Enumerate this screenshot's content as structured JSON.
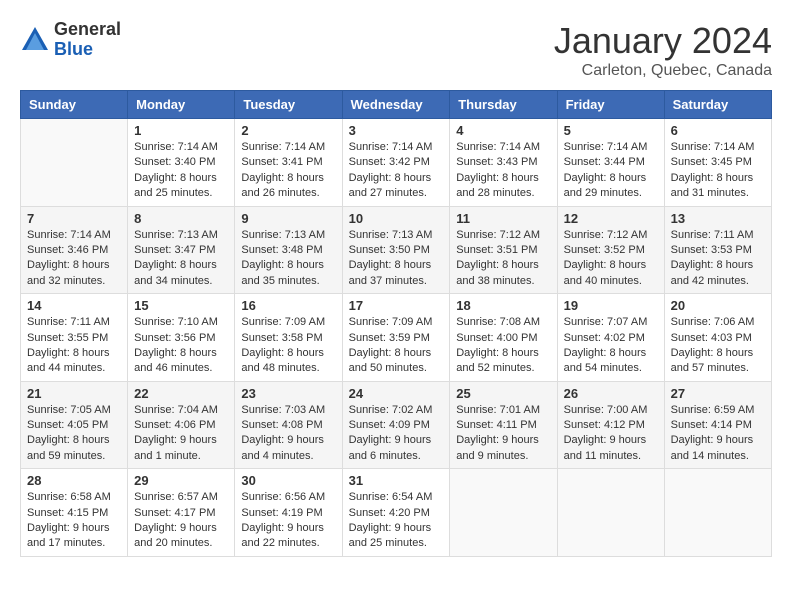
{
  "logo": {
    "general": "General",
    "blue": "Blue"
  },
  "header": {
    "title": "January 2024",
    "subtitle": "Carleton, Quebec, Canada"
  },
  "days_of_week": [
    "Sunday",
    "Monday",
    "Tuesday",
    "Wednesday",
    "Thursday",
    "Friday",
    "Saturday"
  ],
  "weeks": [
    [
      {
        "day": "",
        "info": ""
      },
      {
        "day": "1",
        "info": "Sunrise: 7:14 AM\nSunset: 3:40 PM\nDaylight: 8 hours\nand 25 minutes."
      },
      {
        "day": "2",
        "info": "Sunrise: 7:14 AM\nSunset: 3:41 PM\nDaylight: 8 hours\nand 26 minutes."
      },
      {
        "day": "3",
        "info": "Sunrise: 7:14 AM\nSunset: 3:42 PM\nDaylight: 8 hours\nand 27 minutes."
      },
      {
        "day": "4",
        "info": "Sunrise: 7:14 AM\nSunset: 3:43 PM\nDaylight: 8 hours\nand 28 minutes."
      },
      {
        "day": "5",
        "info": "Sunrise: 7:14 AM\nSunset: 3:44 PM\nDaylight: 8 hours\nand 29 minutes."
      },
      {
        "day": "6",
        "info": "Sunrise: 7:14 AM\nSunset: 3:45 PM\nDaylight: 8 hours\nand 31 minutes."
      }
    ],
    [
      {
        "day": "7",
        "info": "Sunrise: 7:14 AM\nSunset: 3:46 PM\nDaylight: 8 hours\nand 32 minutes."
      },
      {
        "day": "8",
        "info": "Sunrise: 7:13 AM\nSunset: 3:47 PM\nDaylight: 8 hours\nand 34 minutes."
      },
      {
        "day": "9",
        "info": "Sunrise: 7:13 AM\nSunset: 3:48 PM\nDaylight: 8 hours\nand 35 minutes."
      },
      {
        "day": "10",
        "info": "Sunrise: 7:13 AM\nSunset: 3:50 PM\nDaylight: 8 hours\nand 37 minutes."
      },
      {
        "day": "11",
        "info": "Sunrise: 7:12 AM\nSunset: 3:51 PM\nDaylight: 8 hours\nand 38 minutes."
      },
      {
        "day": "12",
        "info": "Sunrise: 7:12 AM\nSunset: 3:52 PM\nDaylight: 8 hours\nand 40 minutes."
      },
      {
        "day": "13",
        "info": "Sunrise: 7:11 AM\nSunset: 3:53 PM\nDaylight: 8 hours\nand 42 minutes."
      }
    ],
    [
      {
        "day": "14",
        "info": "Sunrise: 7:11 AM\nSunset: 3:55 PM\nDaylight: 8 hours\nand 44 minutes."
      },
      {
        "day": "15",
        "info": "Sunrise: 7:10 AM\nSunset: 3:56 PM\nDaylight: 8 hours\nand 46 minutes."
      },
      {
        "day": "16",
        "info": "Sunrise: 7:09 AM\nSunset: 3:58 PM\nDaylight: 8 hours\nand 48 minutes."
      },
      {
        "day": "17",
        "info": "Sunrise: 7:09 AM\nSunset: 3:59 PM\nDaylight: 8 hours\nand 50 minutes."
      },
      {
        "day": "18",
        "info": "Sunrise: 7:08 AM\nSunset: 4:00 PM\nDaylight: 8 hours\nand 52 minutes."
      },
      {
        "day": "19",
        "info": "Sunrise: 7:07 AM\nSunset: 4:02 PM\nDaylight: 8 hours\nand 54 minutes."
      },
      {
        "day": "20",
        "info": "Sunrise: 7:06 AM\nSunset: 4:03 PM\nDaylight: 8 hours\nand 57 minutes."
      }
    ],
    [
      {
        "day": "21",
        "info": "Sunrise: 7:05 AM\nSunset: 4:05 PM\nDaylight: 8 hours\nand 59 minutes."
      },
      {
        "day": "22",
        "info": "Sunrise: 7:04 AM\nSunset: 4:06 PM\nDaylight: 9 hours\nand 1 minute."
      },
      {
        "day": "23",
        "info": "Sunrise: 7:03 AM\nSunset: 4:08 PM\nDaylight: 9 hours\nand 4 minutes."
      },
      {
        "day": "24",
        "info": "Sunrise: 7:02 AM\nSunset: 4:09 PM\nDaylight: 9 hours\nand 6 minutes."
      },
      {
        "day": "25",
        "info": "Sunrise: 7:01 AM\nSunset: 4:11 PM\nDaylight: 9 hours\nand 9 minutes."
      },
      {
        "day": "26",
        "info": "Sunrise: 7:00 AM\nSunset: 4:12 PM\nDaylight: 9 hours\nand 11 minutes."
      },
      {
        "day": "27",
        "info": "Sunrise: 6:59 AM\nSunset: 4:14 PM\nDaylight: 9 hours\nand 14 minutes."
      }
    ],
    [
      {
        "day": "28",
        "info": "Sunrise: 6:58 AM\nSunset: 4:15 PM\nDaylight: 9 hours\nand 17 minutes."
      },
      {
        "day": "29",
        "info": "Sunrise: 6:57 AM\nSunset: 4:17 PM\nDaylight: 9 hours\nand 20 minutes."
      },
      {
        "day": "30",
        "info": "Sunrise: 6:56 AM\nSunset: 4:19 PM\nDaylight: 9 hours\nand 22 minutes."
      },
      {
        "day": "31",
        "info": "Sunrise: 6:54 AM\nSunset: 4:20 PM\nDaylight: 9 hours\nand 25 minutes."
      },
      {
        "day": "",
        "info": ""
      },
      {
        "day": "",
        "info": ""
      },
      {
        "day": "",
        "info": ""
      }
    ]
  ]
}
